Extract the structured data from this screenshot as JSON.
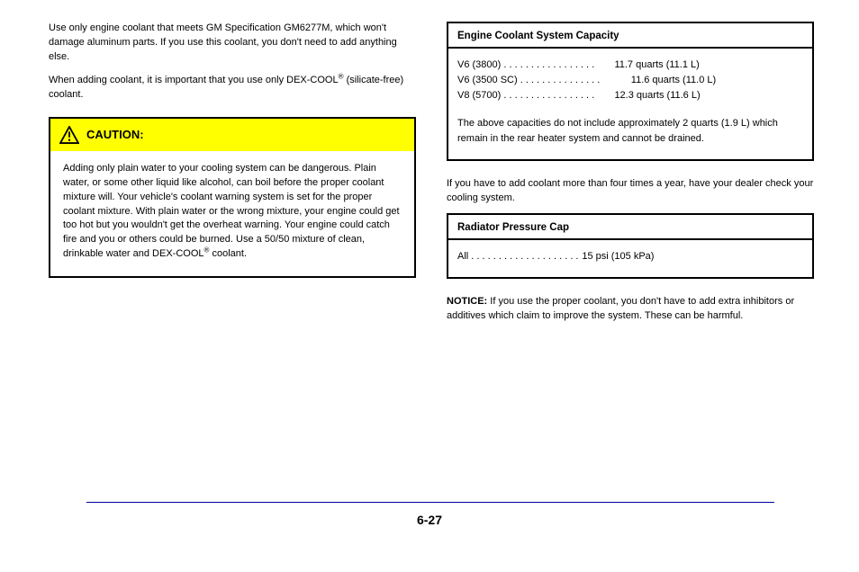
{
  "intro": {
    "p1a": "Use only engine coolant that meets GM Specification GM6277M, which won't damage aluminum parts. If you use this coolant, you don't need to add anything else.",
    "p1b_prefix": "When adding coolant, it is important that you use only DEX-COOL",
    "p1b_reg": "®",
    "p1b_suffix": " (silicate-free) coolant."
  },
  "caution": {
    "heading": "CAUTION:",
    "body_p1": "Adding only plain water to your cooling system can be dangerous. Plain water, or some other liquid like alcohol, can boil before the proper coolant mixture will. Your vehicle's coolant warning system is set for the proper coolant mixture. With plain water or the wrong mixture, your engine could get too hot but you wouldn't get the overheat warning. Your engine could catch fire and you or others could be burned. Use a 50/50 mixture of clean, drinkable water and DEX-COOL",
    "body_reg": "®",
    "body_suffix": " coolant."
  },
  "box_cap": {
    "heading": "Engine Coolant System Capacity",
    "rows": [
      {
        "label": "V6 (3800)",
        "value": "11.7 quarts (11.1 L)"
      },
      {
        "label": "V6 (3500 SC)",
        "value": "11.6 quarts (11.0 L)"
      },
      {
        "label": "V8 (5700)",
        "value": "12.3 quarts (11.6 L)"
      }
    ],
    "footnote": "The above capacities do not include approximately 2 quarts (1.9 L) which remain in the rear heater system and cannot be drained."
  },
  "mid": "If you have to add coolant more than four times a year, have your dealer check your cooling system.",
  "box_press": {
    "heading": "Radiator Pressure Cap",
    "label": "All",
    "value": "15 psi (105 kPa)"
  },
  "notice": {
    "label": "NOTICE:",
    "text": "If you use the proper coolant, you don't have to add extra inhibitors or additives which claim to improve the system. These can be harmful."
  },
  "page_number": "6-27"
}
